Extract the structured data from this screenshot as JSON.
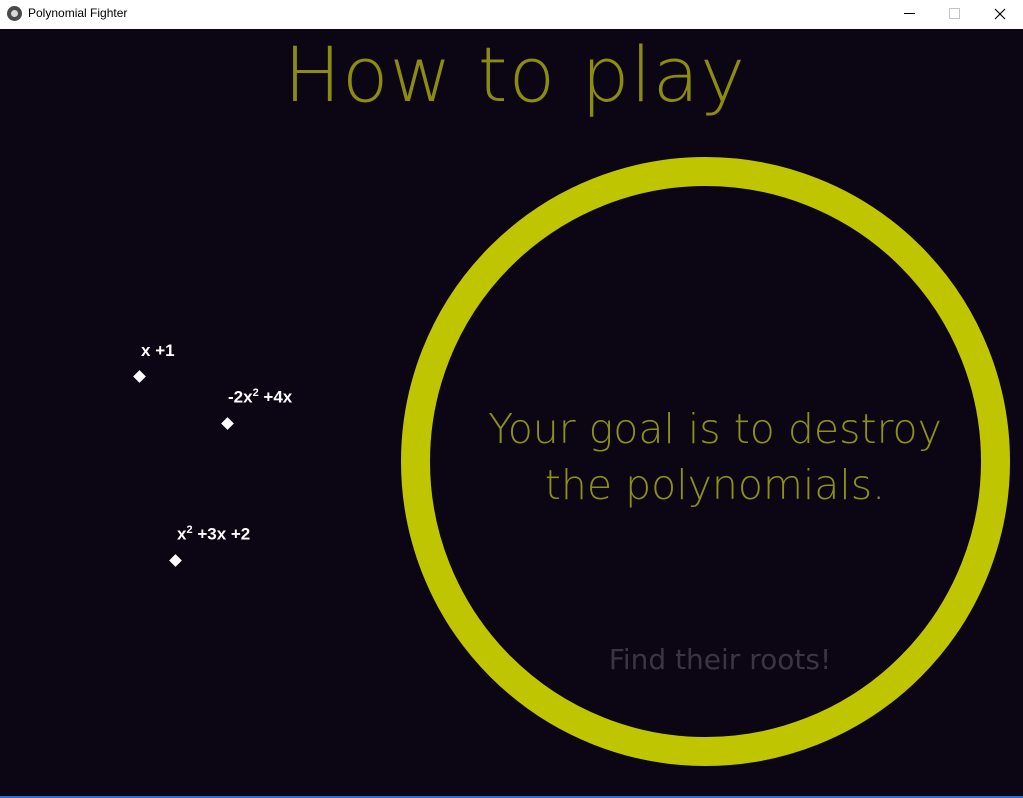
{
  "window": {
    "title": "Polynomial Fighter"
  },
  "screen": {
    "heading": "How to play",
    "goal_line1": "Your goal is to destroy",
    "goal_line2": "the polynomials.",
    "hint": "Find their roots!"
  },
  "polynomials": [
    {
      "term1": "x",
      "term2": " +1"
    },
    {
      "term1": "-2x",
      "exp": "2",
      "term2": " +4x"
    },
    {
      "term1": "x",
      "exp": "2",
      "term2": " +3x +2"
    }
  ],
  "colors": {
    "background": "#0b0514",
    "ring": "#bfc600",
    "heading": "#8c8c10",
    "hint": "#3b3442"
  }
}
